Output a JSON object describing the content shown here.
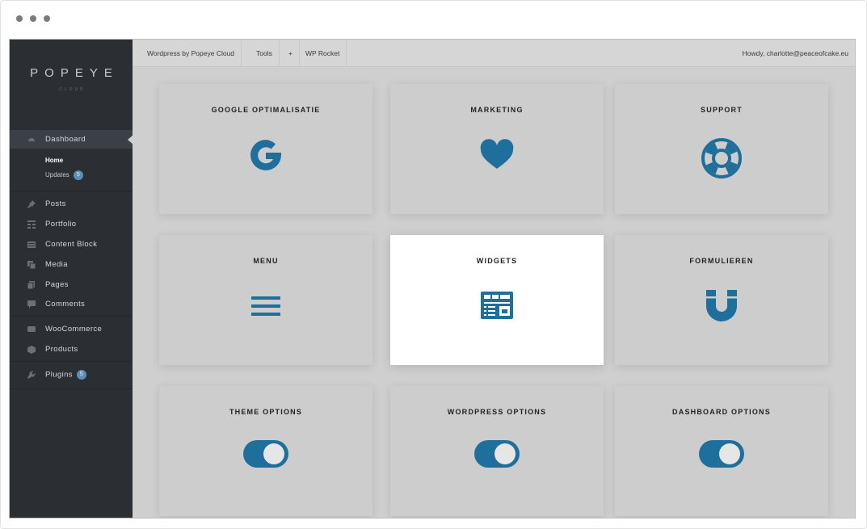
{
  "sidebar": {
    "logo_text": "POPEYE",
    "logo_sub": "CLOUD",
    "dashboard_label": "Dashboard",
    "home_label": "Home",
    "updates_label": "Updates",
    "updates_count": "5",
    "items": [
      {
        "label": "Posts",
        "icon": "pin-icon"
      },
      {
        "label": "Portfolio",
        "icon": "portfolio-icon"
      },
      {
        "label": "Content Block",
        "icon": "content-block-icon"
      },
      {
        "label": "Media",
        "icon": "media-icon"
      },
      {
        "label": "Pages",
        "icon": "pages-icon"
      },
      {
        "label": "Comments",
        "icon": "comment-icon"
      },
      {
        "label": "WooCommerce",
        "icon": "woocommerce-icon"
      },
      {
        "label": "Products",
        "icon": "products-icon"
      },
      {
        "label": "Plugins",
        "icon": "plugin-icon"
      }
    ],
    "plugins_count": "5"
  },
  "topbar": {
    "site": "Wordpress by Popeye Cloud",
    "tools": "Tools",
    "plus": "+",
    "wp_rocket": "WP Rocket",
    "howdy": "Howdy, charlotte@peaceofcake.eu"
  },
  "cards": [
    {
      "title": "GOOGLE OPTIMALISATIE",
      "icon": "google-icon"
    },
    {
      "title": "MARKETING",
      "icon": "heart-icon"
    },
    {
      "title": "SUPPORT",
      "icon": "lifebuoy-icon"
    },
    {
      "title": "MENU",
      "icon": "hamburger-menu-icon"
    },
    {
      "title": "WIDGETS",
      "icon": "widgets-icon",
      "active": true
    },
    {
      "title": "FORMULIEREN",
      "icon": "magnet-icon"
    },
    {
      "title": "THEME OPTIONS",
      "icon": "toggle-icon"
    },
    {
      "title": "WORDPRESS OPTIONS",
      "icon": "toggle-icon"
    },
    {
      "title": "DASHBOARD OPTIONS",
      "icon": "toggle-icon"
    }
  ],
  "colors": {
    "accent": "#1f6f9c",
    "sidebar_bg": "#2b2f34",
    "badge": "#5b8fb5",
    "card_bg": "#cdcdcd",
    "card_active_bg": "#ffffff"
  }
}
